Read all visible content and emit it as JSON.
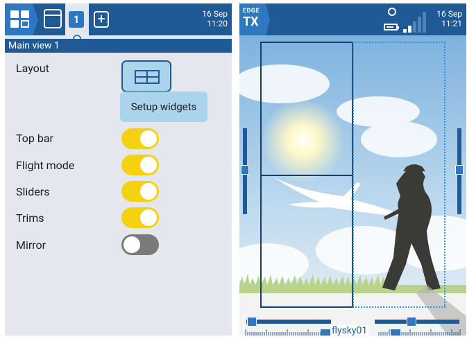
{
  "left_screen": {
    "datetime": {
      "date": "16 Sep",
      "time": "11:20"
    },
    "tabs": {
      "active_number": "1",
      "add_label": "+"
    },
    "page_title": "Main view 1",
    "rows": [
      {
        "label": "Layout"
      },
      {
        "label": "Top bar",
        "value": true
      },
      {
        "label": "Flight mode",
        "value": true
      },
      {
        "label": "Sliders",
        "value": true
      },
      {
        "label": "Trims",
        "value": true
      },
      {
        "label": "Mirror",
        "value": false
      }
    ],
    "setup_widgets_label": "Setup widgets",
    "icons": [
      "home-grid-icon",
      "window-icon",
      "add-view-icon",
      "layout-split-icon"
    ]
  },
  "right_screen": {
    "logo": {
      "line1": "EDGE",
      "line2": "TX"
    },
    "datetime": {
      "date": "16 Sep",
      "time": "11:21"
    },
    "model_name": "flysky01",
    "icons": [
      "volume-icon",
      "battery-icon",
      "signal-bars-icon"
    ]
  },
  "colors": {
    "header_blue": "#1f5a96",
    "accent_blue": "#2e78c1",
    "toggle_on": "#f5d20f",
    "toggle_off": "#7a7a7a",
    "panel_bg": "#e4e8ee"
  }
}
